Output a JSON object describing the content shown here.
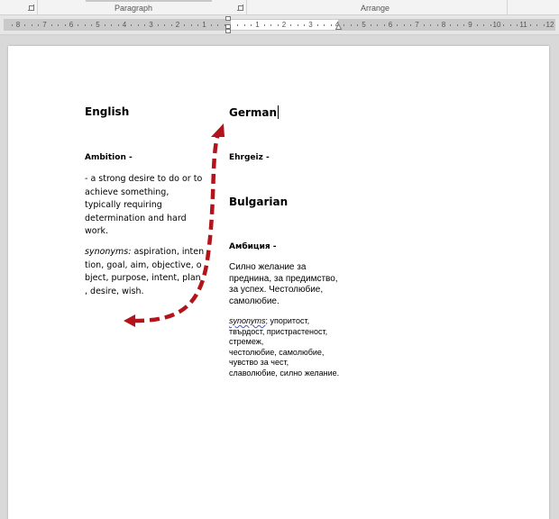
{
  "ribbon": {
    "groups": [
      {
        "label": "Paragraph"
      },
      {
        "label": "Arrange"
      }
    ]
  },
  "ruler": {
    "left_numbers": [
      "8",
      "7",
      "6",
      "5",
      "4",
      "3",
      "2",
      "1"
    ],
    "right_numbers": [
      "1",
      "2",
      "3",
      "4",
      "5",
      "6",
      "7",
      "8",
      "9",
      "10",
      "11",
      "12"
    ]
  },
  "document": {
    "english": {
      "heading": "English",
      "term": "Ambition -",
      "definition_lines": [
        "- a strong desire to do or to",
        "achieve something,",
        "typically requiring",
        "determination and hard",
        "work."
      ],
      "synonyms_label": "synonyms:",
      "synonyms_lines": [
        " aspiration, inten",
        "tion, goal, aim, objective, o",
        "bject, purpose, intent, plan",
        ", desire, wish."
      ]
    },
    "german": {
      "heading": "German",
      "term": "Ehrgeiz -"
    },
    "bulgarian": {
      "heading": "Bulgarian",
      "term": "Амбиция -",
      "definition_lines": [
        "Силно желание за",
        "преднина, за предимство,",
        "за успех. Честолюбие,",
        "самолюбие."
      ],
      "synonyms_label": "synonyms",
      "synonyms_lines": [
        "; упоритост,",
        "твърдост, пристрастеност,",
        "стремеж,",
        "честолюбие, самолюбие,",
        "чувство за чест,",
        "славолюбие, силно желание."
      ]
    }
  },
  "colors": {
    "arrow": "#b3141b",
    "spellcheck": "#3a55d0"
  }
}
